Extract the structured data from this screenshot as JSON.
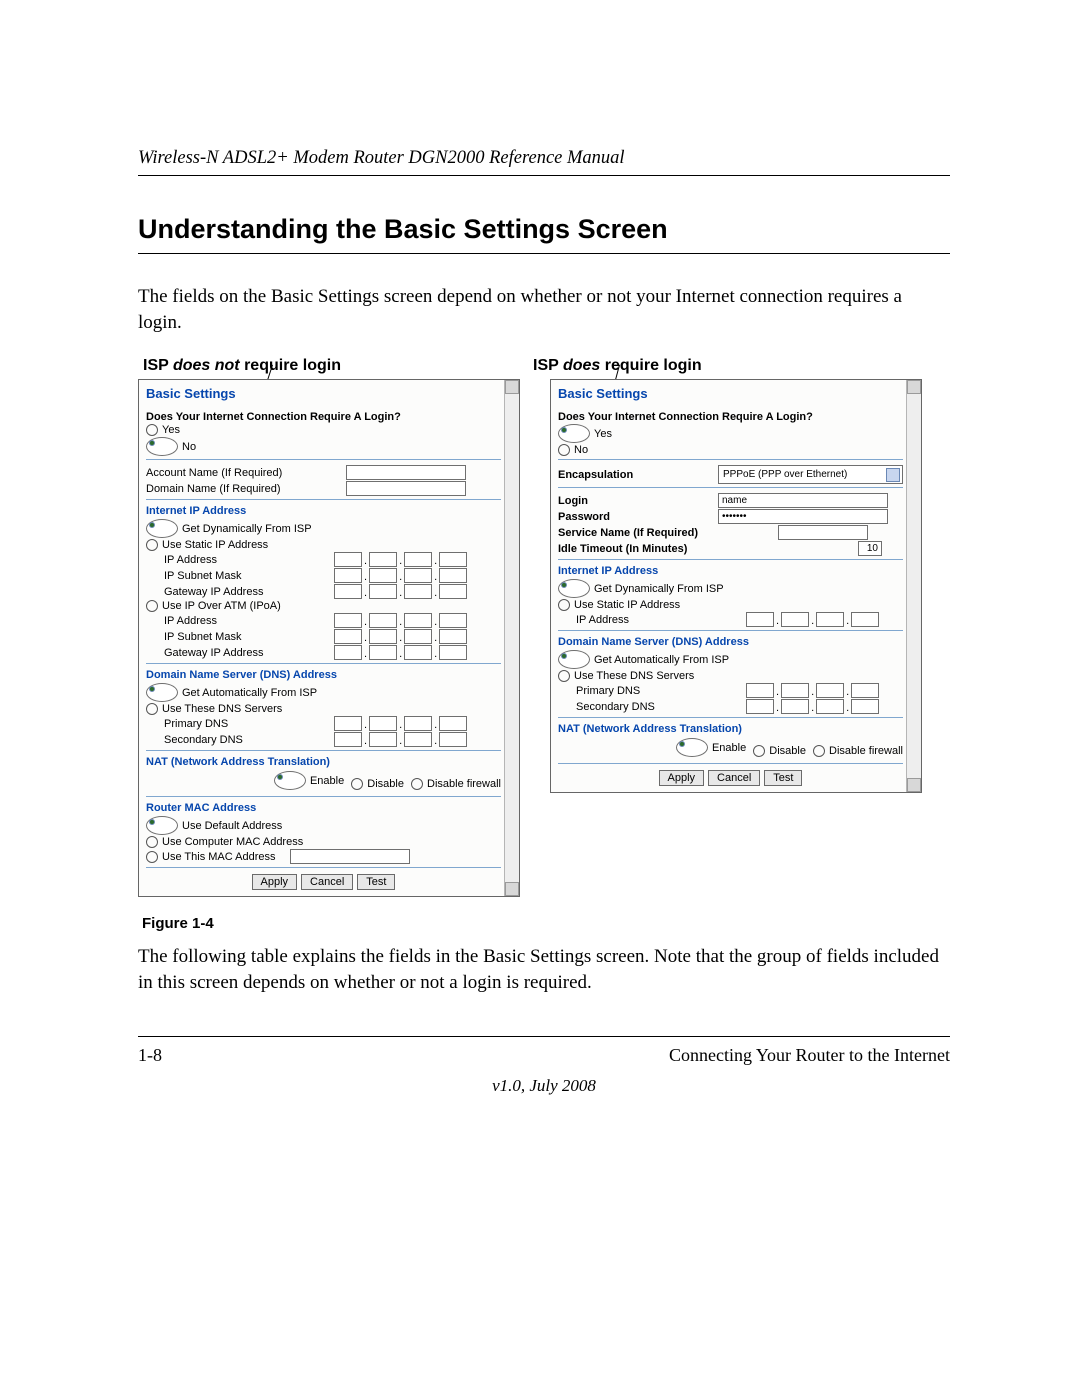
{
  "header": {
    "manual_title": "Wireless-N ADSL2+ Modem Router DGN2000 Reference Manual"
  },
  "section": {
    "heading": "Understanding the Basic Settings Screen"
  },
  "intro_text": "The fields on the Basic Settings screen depend on whether or not your Internet connection requires a login.",
  "captions": {
    "left_prefix": "ISP ",
    "left_emph": "does not",
    "left_suffix": " require login",
    "right_prefix": "ISP ",
    "right_emph": "does",
    "right_suffix": " require login"
  },
  "panel_shared": {
    "title": "Basic Settings",
    "login_q": "Does Your Internet Connection Require A Login?",
    "opt_yes": "Yes",
    "opt_no": "No",
    "iip_head": "Internet IP Address",
    "iip_dyn": "Get Dynamically From ISP",
    "iip_static": "Use Static IP Address",
    "iip_ipoa": "Use IP Over ATM (IPoA)",
    "lbl_ipaddr": "IP Address",
    "lbl_subnet": "IP Subnet Mask",
    "lbl_gwip": "Gateway IP Address",
    "dns_head": "Domain Name Server (DNS) Address",
    "dns_auto": "Get Automatically From ISP",
    "dns_use": "Use These DNS Servers",
    "dns_primary": "Primary DNS",
    "dns_secondary": "Secondary DNS",
    "nat_head": "NAT (Network Address Translation)",
    "nat_enable": "Enable",
    "nat_disable": "Disable",
    "nat_disable_fw": "Disable firewall",
    "btn_apply": "Apply",
    "btn_cancel": "Cancel",
    "btn_test": "Test"
  },
  "left_panel": {
    "acct_name": "Account Name  (If Required)",
    "domain_name": "Domain Name  (If Required)",
    "mac_head": "Router MAC Address",
    "mac_default": "Use Default Address",
    "mac_computer": "Use Computer MAC Address",
    "mac_this": "Use This MAC Address"
  },
  "right_panel": {
    "encap_label": "Encapsulation",
    "encap_value": "PPPoE (PPP over Ethernet)",
    "login_label": "Login",
    "login_value": "name",
    "pass_label": "Password",
    "pass_value": "•••••••",
    "svc_label": "Service Name (If Required)",
    "idle_label": "Idle Timeout (In Minutes)",
    "idle_value": "10"
  },
  "figure_label": "Figure 1-4",
  "outro_text": "The following table explains the fields in the Basic Settings screen. Note that the group of fields included in this screen depends on whether or not a login is required.",
  "footer": {
    "page_num": "1-8",
    "chapter": "Connecting Your Router to the Internet",
    "version": "v1.0, July 2008"
  }
}
